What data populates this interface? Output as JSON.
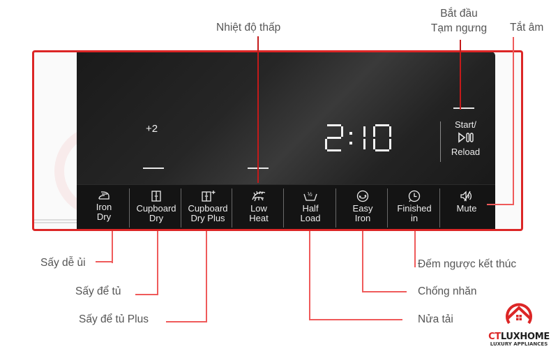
{
  "colors": {
    "accent": "#dc2626",
    "leader": "#ef5a5a",
    "panel": "#1a1a1a",
    "label_text": "#555555",
    "panel_text": "#ececec"
  },
  "panel": {
    "temperature_offset": "+2",
    "time_display": "2:10",
    "start_button": {
      "line1": "Start/",
      "icon": "play-pause-icon",
      "line2": "Reload"
    },
    "buttons": [
      {
        "line1": "Iron",
        "line2": "Dry",
        "icon": "iron-icon"
      },
      {
        "line1": "Cupboard",
        "line2": "Dry",
        "icon": "cupboard-icon"
      },
      {
        "line1": "Cupboard",
        "line2": "Dry Plus",
        "icon": "cupboard-plus-icon"
      },
      {
        "line1": "Low",
        "line2": "Heat",
        "icon": "low-heat-icon"
      },
      {
        "line1": "Half",
        "line2": "Load",
        "icon": "half-load-icon"
      },
      {
        "line1": "Easy",
        "line2": "Iron",
        "icon": "easy-iron-icon"
      },
      {
        "line1": "Finished",
        "line2": "in",
        "icon": "clock-icon"
      },
      {
        "line1": "Mute",
        "line2": "",
        "icon": "mute-icon"
      }
    ]
  },
  "callouts": {
    "low_heat": "Nhiệt độ thấp",
    "start_pause_line1": "Bắt đầu",
    "start_pause_line2": "Tạm ngưng",
    "mute": "Tắt âm",
    "iron_dry": "Sấy dễ ủi",
    "cupboard_dry": "Sấy để tủ",
    "cupboard_dry_plus": "Sấy để tủ Plus",
    "finished_in": "Đếm ngược kết thúc",
    "easy_iron": "Chống nhăn",
    "half_load": "Nửa tải"
  },
  "logo": {
    "brand_ct": "CT",
    "brand_rest": "LUXHOME",
    "tagline": "LUXURY APPLIANCES"
  }
}
